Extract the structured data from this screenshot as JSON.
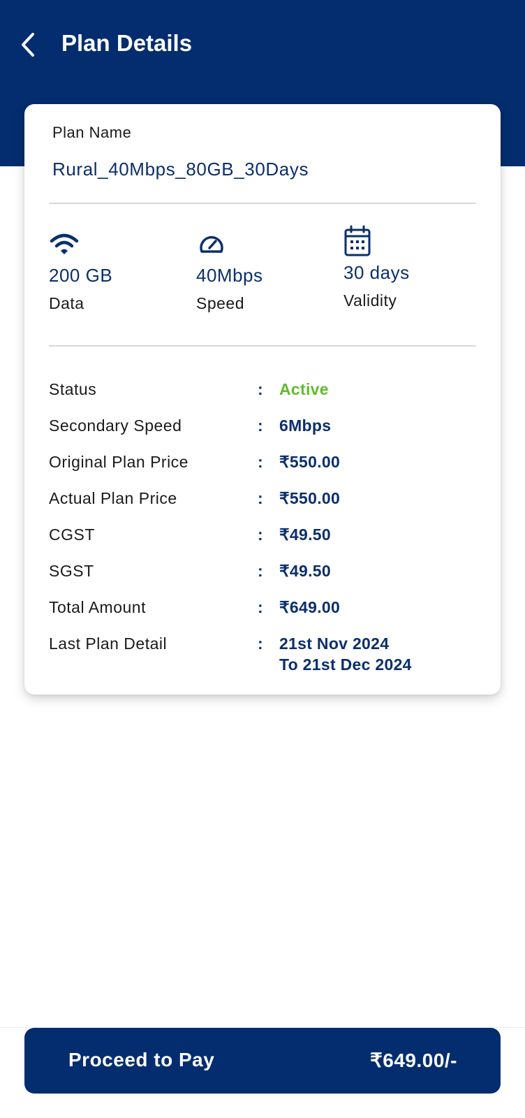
{
  "header": {
    "title": "Plan Details",
    "back_icon": "chevron-left-icon"
  },
  "plan": {
    "name_label": "Plan Name",
    "name_value": "Rural_40Mbps_80GB_30Days"
  },
  "features": [
    {
      "icon": "wifi-icon",
      "value": "200 GB",
      "label": "Data"
    },
    {
      "icon": "speedometer-icon",
      "value": "40Mbps",
      "label": "Speed"
    },
    {
      "icon": "calendar-icon",
      "value": "30 days",
      "label": "Validity"
    }
  ],
  "details": [
    {
      "label": "Status",
      "value": "Active"
    },
    {
      "label": "Secondary Speed",
      "value": "6Mbps"
    },
    {
      "label": "Original Plan Price",
      "value": "₹550.00"
    },
    {
      "label": "Actual Plan Price",
      "value": "₹550.00"
    },
    {
      "label": "CGST",
      "value": "₹49.50"
    },
    {
      "label": "SGST",
      "value": "₹49.50"
    },
    {
      "label": "Total Amount",
      "value": "₹649.00"
    },
    {
      "label": "Last Plan Detail",
      "value_line1": "21st Nov 2024",
      "value_line2": "To 21st Dec 2024"
    }
  ],
  "separator": ":",
  "pay_button": {
    "label": "Proceed to Pay",
    "amount": "₹649.00/-"
  },
  "colors": {
    "primary": "#032d6e",
    "text_blue": "#0b2f6b",
    "status_active": "#62bb2f"
  }
}
